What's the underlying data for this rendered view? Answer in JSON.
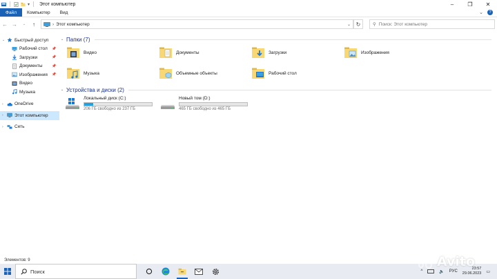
{
  "window": {
    "title": "Этот компьютер",
    "controls": [
      "–",
      "❐",
      "✕"
    ]
  },
  "ribbon": {
    "tabs": [
      "Файл",
      "Компьютер",
      "Вид"
    ]
  },
  "address": {
    "path": "Этот компьютер",
    "separator": "›"
  },
  "search": {
    "placeholder": "Поиск: Этот компьютер"
  },
  "nav": {
    "quick_access": "Быстрый доступ",
    "quick_items": [
      {
        "label": "Рабочий стол",
        "icon": "desktop-icon",
        "pinned": true
      },
      {
        "label": "Загрузки",
        "icon": "downloads-icon",
        "pinned": true
      },
      {
        "label": "Документы",
        "icon": "documents-icon",
        "pinned": true
      },
      {
        "label": "Изображения",
        "icon": "pictures-icon",
        "pinned": true
      },
      {
        "label": "Видео",
        "icon": "videos-icon",
        "pinned": false
      },
      {
        "label": "Музыка",
        "icon": "music-icon",
        "pinned": false
      }
    ],
    "onedrive": "OneDrive",
    "this_pc": "Этот компьютер",
    "network": "Сеть"
  },
  "folders_group": {
    "title": "Папки (7)",
    "items": [
      "Видео",
      "Документы",
      "Загрузки",
      "Изображения",
      "Музыка",
      "Объемные объекты",
      "Рабочий стол"
    ]
  },
  "drives_group": {
    "title": "Устройства и диски (2)",
    "items": [
      {
        "name": "Локальный диск (C:)",
        "free": "206 ГБ свободно из 237 ГБ",
        "used_fraction": 0.13
      },
      {
        "name": "Новый том (D:)",
        "free": "465 ГБ свободно из 465 ГБ",
        "used_fraction": 0.0
      }
    ]
  },
  "status": {
    "items": "Элементов: 9"
  },
  "taskbar": {
    "search_placeholder": "Поиск",
    "language": "РУС",
    "time": "23:57",
    "date": "29.06.2023"
  },
  "watermark": "Avito",
  "colors": {
    "accent": "#1a62b5",
    "selection": "#cce8ff",
    "group_title": "#1e3287",
    "drive_fill": "#26a0da",
    "folder_yellow": "#f8d775"
  }
}
